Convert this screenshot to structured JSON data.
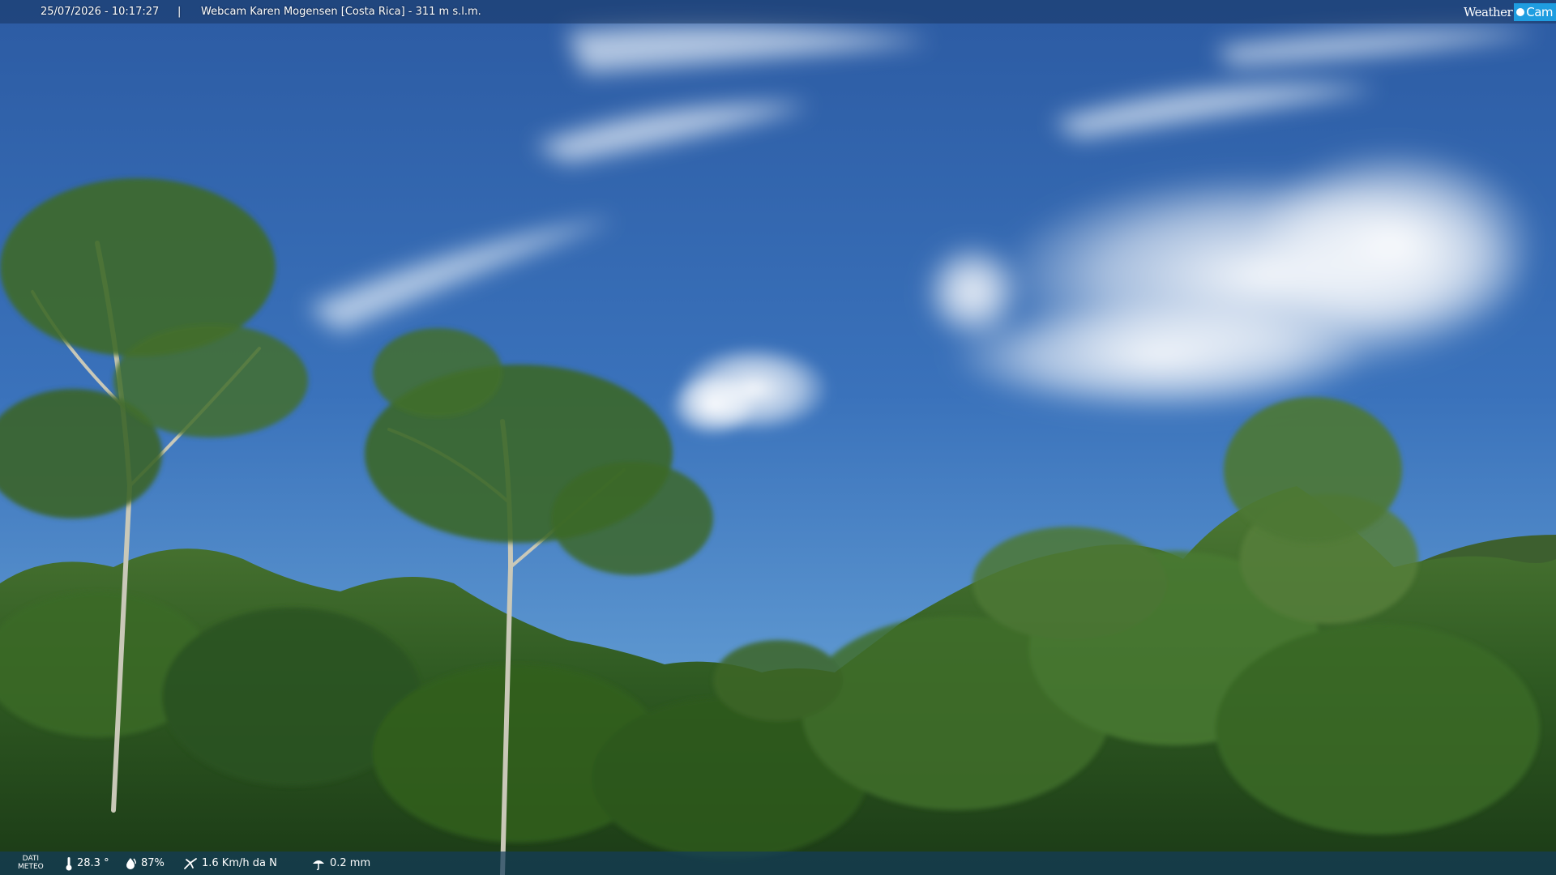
{
  "top_bar": {
    "timestamp": "25/07/2026 - 10:17:27",
    "separator": "|",
    "title": "Webcam Karen Mogensen [Costa Rica] - 311 m s.l.m."
  },
  "logo": {
    "part1": "Weather",
    "part2": "Cam",
    "accent_color": "#1f9de0"
  },
  "weather_bar": {
    "label_line1": "DATI",
    "label_line2": "METEO",
    "temperature": "28.3 °",
    "humidity": "87%",
    "wind": "1.6 Km/h da N",
    "rain": "0.2 mm",
    "icons": [
      "thermometer-icon",
      "humidity-icon",
      "wind-icon",
      "rain-icon"
    ]
  },
  "scene": {
    "sky_top_color": "#2f5ea6",
    "sky_bottom_color": "#5b95cf",
    "foliage_color": "#2f5a22"
  }
}
